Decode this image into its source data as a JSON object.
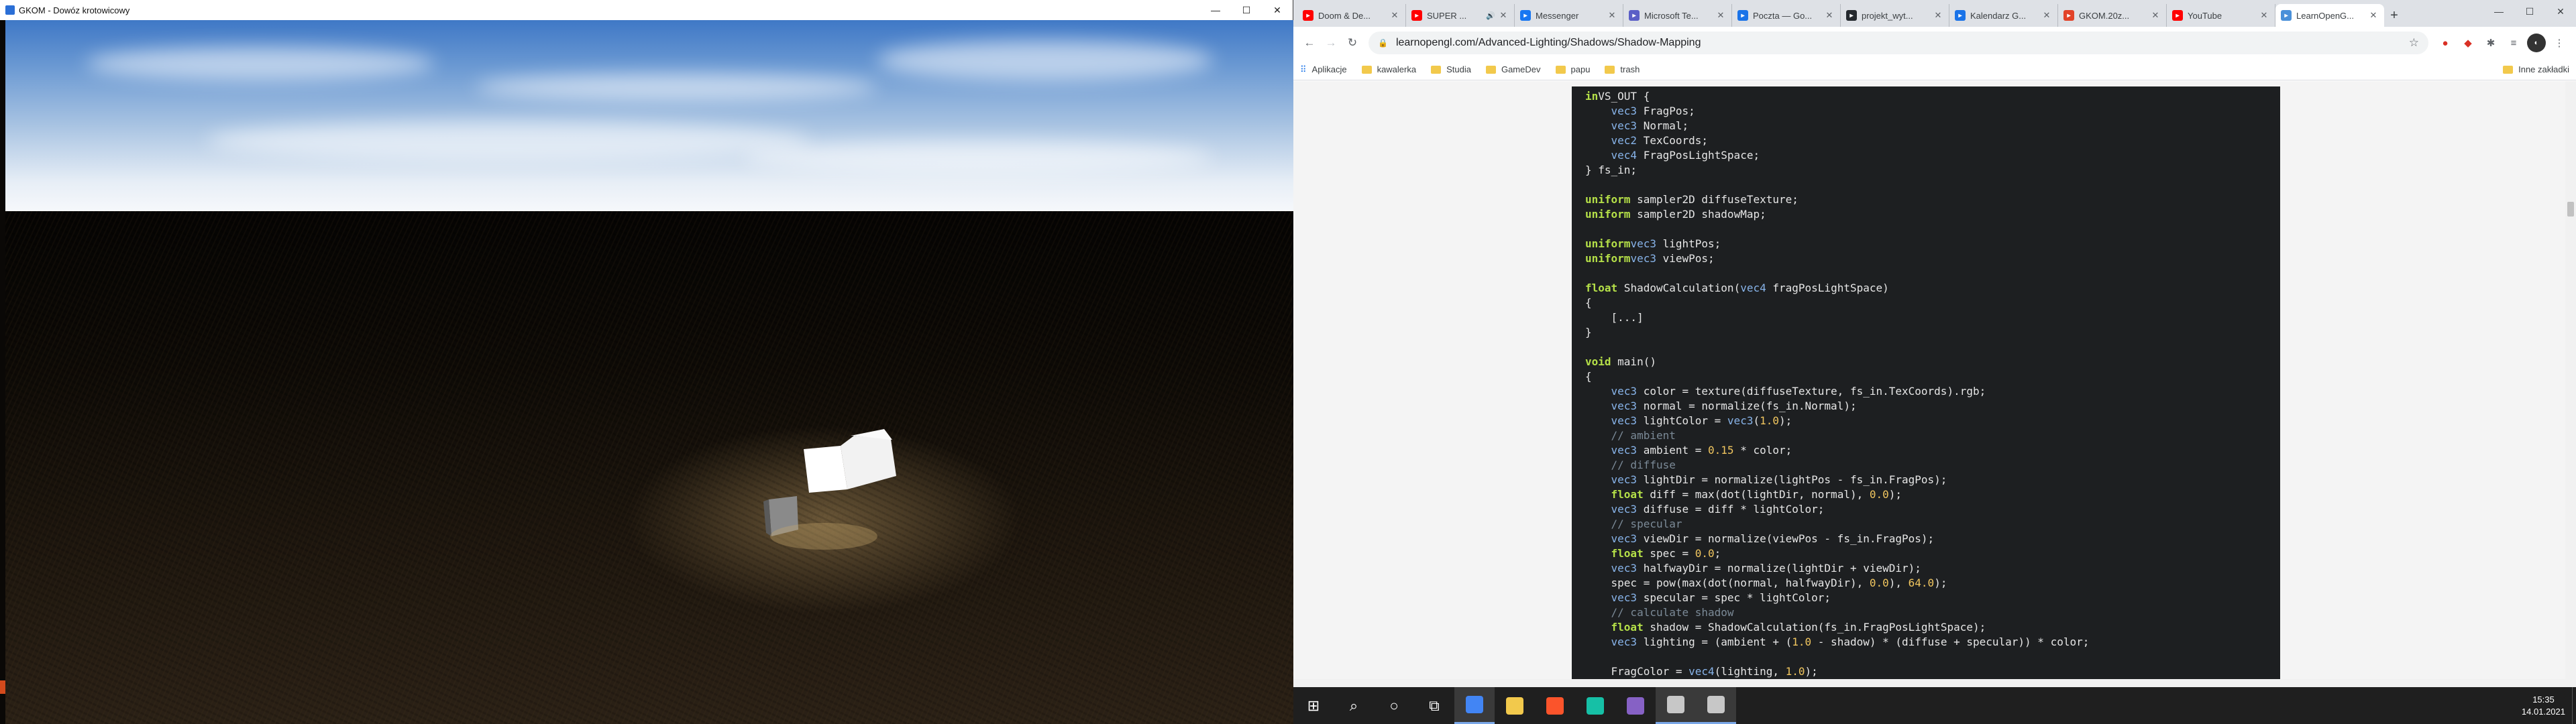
{
  "gl_window": {
    "title": "GKOM - Dowóz krotowicowy",
    "controls": {
      "minimize": "—",
      "maximize": "☐",
      "close": "✕"
    }
  },
  "chrome": {
    "tabs": [
      {
        "label": "Doom & De...",
        "icon": "youtube-icon",
        "color": "#ff0000"
      },
      {
        "label": "SUPER ...",
        "icon": "youtube-icon",
        "color": "#ff0000",
        "audio": true
      },
      {
        "label": "Messenger",
        "icon": "facebook-icon",
        "color": "#1877f2"
      },
      {
        "label": "Microsoft Te...",
        "icon": "teams-icon",
        "color": "#5b5fc7"
      },
      {
        "label": "Poczta — Go...",
        "icon": "mail-icon",
        "color": "#1a73e8"
      },
      {
        "label": "projekt_wyt...",
        "icon": "github-icon",
        "color": "#24292e"
      },
      {
        "label": "Kalendarz G...",
        "icon": "calendar-icon",
        "color": "#1a73e8"
      },
      {
        "label": "GKOM.20z...",
        "icon": "gitlab-icon",
        "color": "#e24329"
      },
      {
        "label": "YouTube",
        "icon": "youtube-icon",
        "color": "#ff0000"
      },
      {
        "label": "LearnOpenG...",
        "icon": "learnopengl-icon",
        "color": "#4a90d9",
        "active": true
      }
    ],
    "new_tab": "+",
    "controls": {
      "minimize": "—",
      "maximize": "☐",
      "close": "✕"
    },
    "url": "learnopengl.com/Advanced-Lighting/Shadows/Shadow-Mapping",
    "bookmarks": [
      {
        "label": "Aplikacje",
        "kind": "apps"
      },
      {
        "label": "kawalerka",
        "kind": "folder"
      },
      {
        "label": "Studia",
        "kind": "folder"
      },
      {
        "label": "GameDev",
        "kind": "folder"
      },
      {
        "label": "papu",
        "kind": "folder"
      },
      {
        "label": "trash",
        "kind": "folder"
      }
    ],
    "other_bookmarks": "Inne zakładki"
  },
  "code_lines": [
    [
      [
        "kw",
        "in"
      ],
      [
        "",
        "VS_OUT {"
      ]
    ],
    [
      [
        "",
        "    "
      ],
      [
        "ty",
        "vec3"
      ],
      [
        "",
        " FragPos;"
      ]
    ],
    [
      [
        "",
        "    "
      ],
      [
        "ty",
        "vec3"
      ],
      [
        "",
        " Normal;"
      ]
    ],
    [
      [
        "",
        "    "
      ],
      [
        "ty",
        "vec2"
      ],
      [
        "",
        " TexCoords;"
      ]
    ],
    [
      [
        "",
        "    "
      ],
      [
        "ty",
        "vec4"
      ],
      [
        "",
        " FragPosLightSpace;"
      ]
    ],
    [
      [
        "",
        "} fs_in;"
      ]
    ],
    [],
    [
      [
        "kw",
        "uniform"
      ],
      [
        "",
        " sampler2D diffuseTexture;"
      ]
    ],
    [
      [
        "kw",
        "uniform"
      ],
      [
        "",
        " sampler2D shadowMap;"
      ]
    ],
    [],
    [
      [
        "kw",
        "uniform"
      ],
      [
        " ",
        ""
      ],
      [
        "ty",
        "vec3"
      ],
      [
        "",
        " lightPos;"
      ]
    ],
    [
      [
        "kw",
        "uniform"
      ],
      [
        " ",
        ""
      ],
      [
        "ty",
        "vec3"
      ],
      [
        "",
        " viewPos;"
      ]
    ],
    [],
    [
      [
        "kw",
        "float"
      ],
      [
        "",
        " ShadowCalculation("
      ],
      [
        "ty",
        "vec4"
      ],
      [
        "",
        " fragPosLightSpace)"
      ]
    ],
    [
      [
        "",
        "{"
      ]
    ],
    [
      [
        "",
        "    [...]"
      ]
    ],
    [
      [
        "",
        "}"
      ]
    ],
    [],
    [
      [
        "kw",
        "void"
      ],
      [
        "",
        " main()"
      ]
    ],
    [
      [
        "",
        "{"
      ]
    ],
    [
      [
        "",
        "    "
      ],
      [
        "ty",
        "vec3"
      ],
      [
        "",
        " color = texture(diffuseTexture, fs_in.TexCoords).rgb;"
      ]
    ],
    [
      [
        "",
        "    "
      ],
      [
        "ty",
        "vec3"
      ],
      [
        "",
        " normal = normalize(fs_in.Normal);"
      ]
    ],
    [
      [
        "",
        "    "
      ],
      [
        "ty",
        "vec3"
      ],
      [
        "",
        " lightColor = "
      ],
      [
        "ty",
        "vec3"
      ],
      [
        "",
        "("
      ],
      [
        "nm",
        "1.0"
      ],
      [
        "",
        ");"
      ]
    ],
    [
      [
        "cm",
        "    // ambient"
      ]
    ],
    [
      [
        "",
        "    "
      ],
      [
        "ty",
        "vec3"
      ],
      [
        "",
        " ambient = "
      ],
      [
        "nm",
        "0.15"
      ],
      [
        "",
        " * color;"
      ]
    ],
    [
      [
        "cm",
        "    // diffuse"
      ]
    ],
    [
      [
        "",
        "    "
      ],
      [
        "ty",
        "vec3"
      ],
      [
        "",
        " lightDir = normalize(lightPos - fs_in.FragPos);"
      ]
    ],
    [
      [
        "",
        "    "
      ],
      [
        "kw",
        "float"
      ],
      [
        "",
        " diff = max(dot(lightDir, normal), "
      ],
      [
        "nm",
        "0.0"
      ],
      [
        "",
        ");"
      ]
    ],
    [
      [
        "",
        "    "
      ],
      [
        "ty",
        "vec3"
      ],
      [
        "",
        " diffuse = diff * lightColor;"
      ]
    ],
    [
      [
        "cm",
        "    // specular"
      ]
    ],
    [
      [
        "",
        "    "
      ],
      [
        "ty",
        "vec3"
      ],
      [
        "",
        " viewDir = normalize(viewPos - fs_in.FragPos);"
      ]
    ],
    [
      [
        "",
        "    "
      ],
      [
        "kw",
        "float"
      ],
      [
        "",
        " spec = "
      ],
      [
        "nm",
        "0.0"
      ],
      [
        "",
        ";"
      ]
    ],
    [
      [
        "",
        "    "
      ],
      [
        "ty",
        "vec3"
      ],
      [
        "",
        " halfwayDir = normalize(lightDir + viewDir);"
      ]
    ],
    [
      [
        "",
        "    spec = pow(max(dot(normal, halfwayDir), "
      ],
      [
        "nm",
        "0.0"
      ],
      [
        "",
        "), "
      ],
      [
        "nm",
        "64.0"
      ],
      [
        "",
        ");"
      ]
    ],
    [
      [
        "",
        "    "
      ],
      [
        "ty",
        "vec3"
      ],
      [
        "",
        " specular = spec * lightColor;"
      ]
    ],
    [
      [
        "cm",
        "    // calculate shadow"
      ]
    ],
    [
      [
        "",
        "    "
      ],
      [
        "kw",
        "float"
      ],
      [
        "",
        " shadow = ShadowCalculation(fs_in.FragPosLightSpace);"
      ]
    ],
    [
      [
        "",
        "    "
      ],
      [
        "ty",
        "vec3"
      ],
      [
        "",
        " lighting = (ambient + ("
      ],
      [
        "nm",
        "1.0"
      ],
      [
        "",
        " - shadow) * (diffuse + specular)) * color;"
      ]
    ],
    [],
    [
      [
        "",
        "    FragColor = "
      ],
      [
        "ty",
        "vec4"
      ],
      [
        "",
        "(lighting, "
      ],
      [
        "nm",
        "1.0"
      ],
      [
        "",
        ");"
      ]
    ]
  ],
  "taskbar": {
    "items": [
      {
        "name": "start-button",
        "glyph": "⊞"
      },
      {
        "name": "search-button",
        "glyph": "⌕"
      },
      {
        "name": "cortana-button",
        "glyph": "○"
      },
      {
        "name": "task-view-button",
        "glyph": "⧉"
      },
      {
        "name": "chrome-app",
        "color": "#4285f4",
        "active": true
      },
      {
        "name": "explorer-app",
        "color": "#f2c94c"
      },
      {
        "name": "brave-app",
        "color": "#fb542b"
      },
      {
        "name": "gitkraken-app",
        "color": "#16c0a6"
      },
      {
        "name": "visual-studio-app",
        "color": "#8661c5"
      },
      {
        "name": "terminal-app",
        "color": "#c7c7c7",
        "active": true
      },
      {
        "name": "gkom-app",
        "color": "#c7c7c7",
        "active": true
      }
    ],
    "time": "15:35",
    "date": "14.01.2021"
  }
}
